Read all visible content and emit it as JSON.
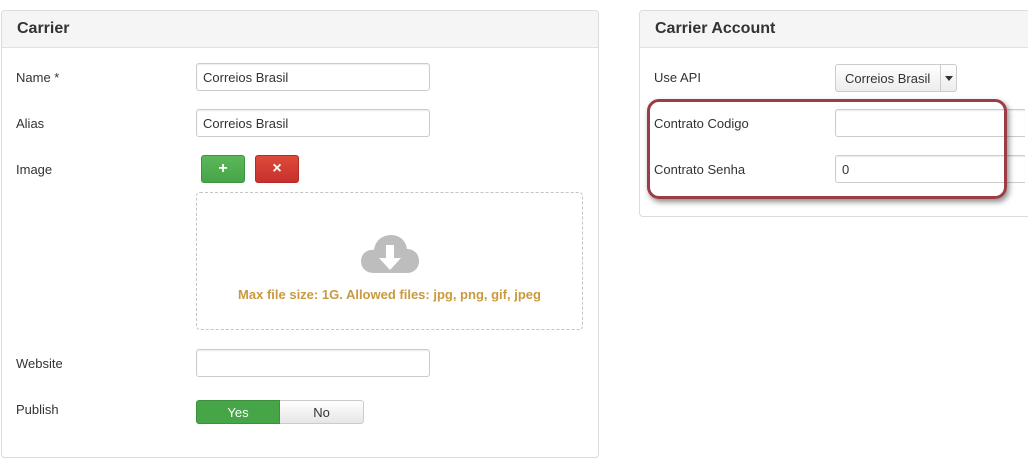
{
  "carrier": {
    "title": "Carrier",
    "name_label": "Name *",
    "name_value": "Correios Brasil",
    "alias_label": "Alias",
    "alias_value": "Correios Brasil",
    "image_label": "Image",
    "add_button": "+",
    "remove_button": "×",
    "dropzone_icon": "cloud-download-icon",
    "dropzone_hint": "Max file size: 1G. Allowed files: jpg, png, gif, jpeg",
    "website_label": "Website",
    "website_value": "",
    "publish_label": "Publish",
    "publish_yes": "Yes",
    "publish_no": "No",
    "publish_selected": "Yes"
  },
  "account": {
    "title": "Carrier Account",
    "use_api_label": "Use API",
    "use_api_value": "Correios Brasil",
    "contrato_codigo_label": "Contrato Codigo",
    "contrato_codigo_value": "",
    "contrato_senha_label": "Contrato Senha",
    "contrato_senha_value": "0"
  },
  "colors": {
    "highlight_border": "#9c3d46",
    "success": "#46a546",
    "danger": "#c9302c",
    "hint_text": "#c99a40"
  }
}
